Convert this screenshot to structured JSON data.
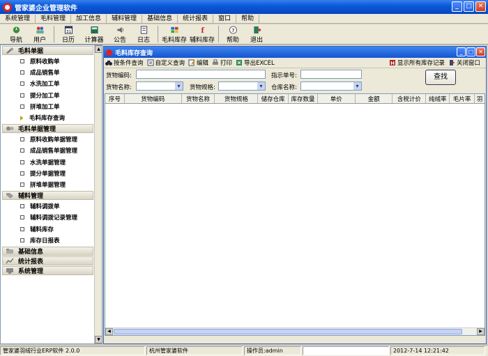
{
  "app": {
    "title": "管家婆企业管理软件"
  },
  "menu": [
    "系统管理",
    "毛料管理",
    "加工信息",
    "辅料管理",
    "基础信息",
    "统计报表",
    "窗口",
    "帮助"
  ],
  "toolbar": [
    {
      "label": "导航",
      "icon": "compass-icon"
    },
    {
      "label": "用户",
      "icon": "users-icon"
    },
    {
      "label": "日历",
      "icon": "calendar-icon"
    },
    {
      "label": "计算器",
      "icon": "calculator-icon"
    },
    {
      "label": "公告",
      "icon": "speaker-icon"
    },
    {
      "label": "日志",
      "icon": "log-icon"
    },
    {
      "label": "毛料库存",
      "icon": "stock-icon"
    },
    {
      "label": "辅料库存",
      "icon": "aux-stock-icon"
    },
    {
      "label": "帮助",
      "icon": "help-icon"
    },
    {
      "label": "退出",
      "icon": "exit-icon"
    }
  ],
  "sidebar": {
    "groups": [
      {
        "label": "毛料单据",
        "items": [
          "原料收购单",
          "成品销售单",
          "水洗加工单",
          "提分加工单",
          "拼堆加工单",
          "毛料库存查询"
        ]
      },
      {
        "label": "毛料单据管理",
        "items": [
          "原料收购单据管理",
          "成品销售单据管理",
          "水洗单据管理",
          "提分单据管理",
          "拼堆单据管理"
        ]
      },
      {
        "label": "辅料管理",
        "items": [
          "辅料调拨单",
          "辅料调拨记录管理",
          "辅料库存",
          "库存日报表"
        ]
      },
      {
        "label": "基础信息",
        "items": []
      },
      {
        "label": "统计报表",
        "items": []
      },
      {
        "label": "系统管理",
        "items": []
      }
    ],
    "current_item": "毛料库存查询"
  },
  "child": {
    "title": "毛料库存查询",
    "actions": [
      {
        "label": "按条件查询",
        "icon": "binoculars-icon"
      },
      {
        "label": "自定义查询",
        "icon": "custom-query-icon"
      },
      {
        "label": "编辑",
        "icon": "edit-icon"
      },
      {
        "label": "打印",
        "icon": "print-icon"
      },
      {
        "label": "导出EXCEL",
        "icon": "export-icon"
      }
    ],
    "right_actions": [
      {
        "label": "显示所有库存记录",
        "icon": "show-all-icon"
      },
      {
        "label": "关闭窗口",
        "icon": "close-window-icon"
      }
    ],
    "form": {
      "goods_code_label": "货物编码:",
      "goods_name_label": "货物名称:",
      "goods_spec_label": "货物规格:",
      "instruction_no_label": "指示单号:",
      "warehouse_label": "仓库名称:",
      "goods_code": "",
      "goods_name": "",
      "goods_spec": "",
      "instruction_no": "",
      "warehouse": "",
      "find_label": "查找"
    },
    "columns": [
      "序号",
      "货物编码",
      "货物名称",
      "货物规格",
      "储存仓库",
      "库存数量",
      "单价",
      "金额",
      "含税计价",
      "纯绒率",
      "毛片率",
      "羽"
    ]
  },
  "status": {
    "version": "管家婆羽绒行业ERP软件 2.0.0",
    "company": "杭州管家婆软件",
    "operator": "操作员:admin",
    "datetime": "2012-7-14 12:21:42"
  }
}
